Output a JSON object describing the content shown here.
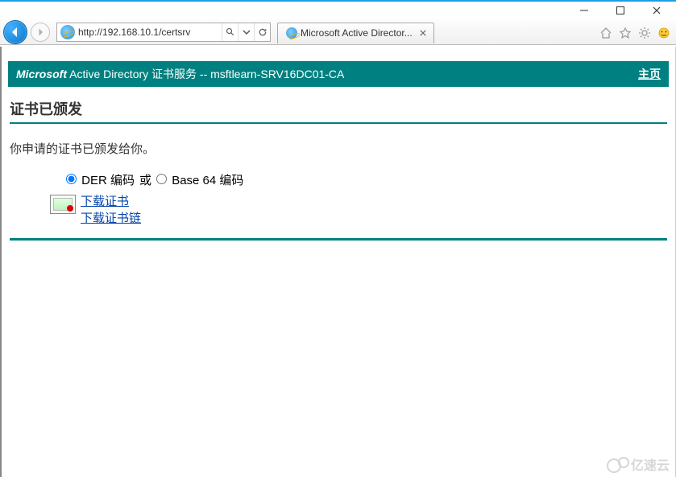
{
  "window": {
    "minimize": "—",
    "maximize": "☐",
    "close": "✕"
  },
  "toolbar": {
    "url": "http://192.168.10.1/certsrv",
    "search_icon": "search",
    "dropdown_icon": "caret",
    "refresh_icon": "refresh"
  },
  "tab": {
    "title": "Microsoft Active Director..."
  },
  "banner": {
    "brand": "Microsoft",
    "service_text": " Active Directory 证书服务  --  msftlearn-SRV16DC01-CA",
    "home_link": "主页"
  },
  "page": {
    "heading": "证书已颁发",
    "message": "你申请的证书已颁发给你。",
    "radio_der": "DER 编码",
    "radio_or": "或",
    "radio_b64": "Base 64 编码",
    "download_cert": "下载证书",
    "download_chain": "下载证书链"
  },
  "watermark": {
    "text": "亿速云"
  }
}
